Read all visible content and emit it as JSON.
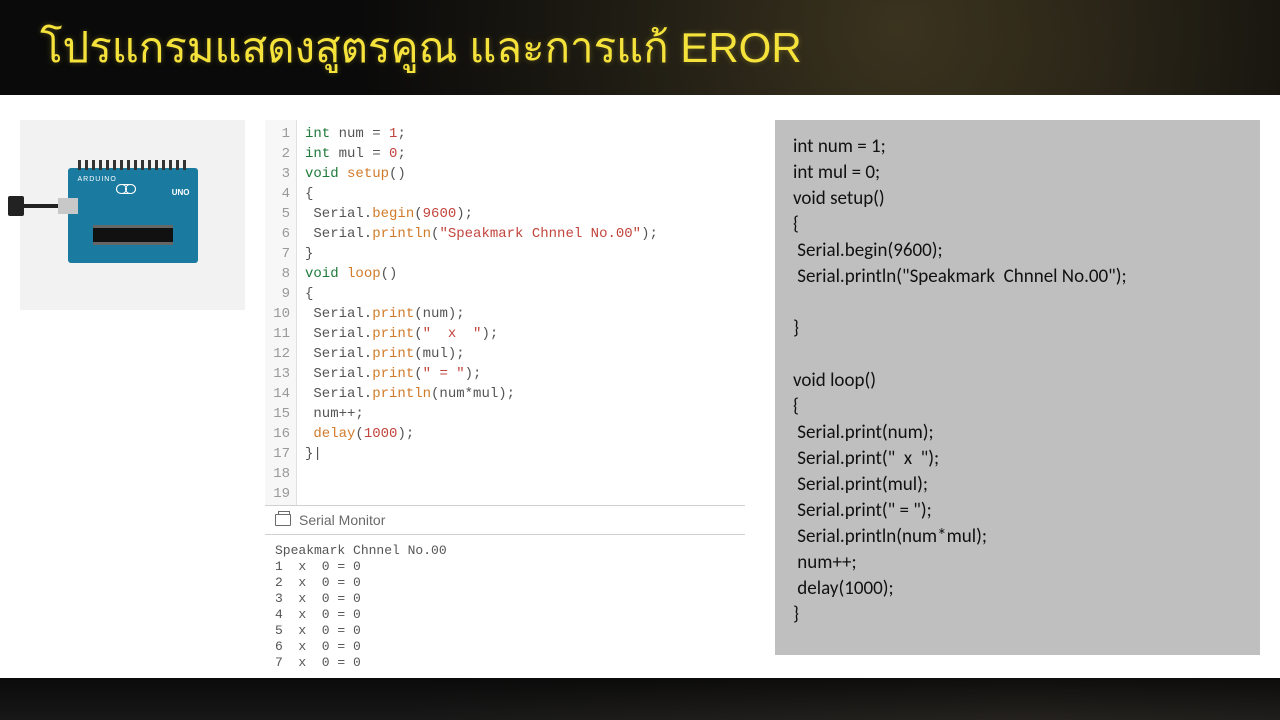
{
  "header": {
    "title": "โปรแกรมแสดงสูตรคูณ และการแก้ EROR"
  },
  "board": {
    "brand": "ARDUINO",
    "model": "UNO"
  },
  "editor": {
    "lines": [
      {
        "n": 1,
        "t": "int num = 1;",
        "tokens": [
          [
            "kw",
            "int"
          ],
          [
            "",
            " num "
          ],
          [
            "punct",
            "="
          ],
          [
            "",
            " "
          ],
          [
            "num",
            "1"
          ],
          [
            "punct",
            ";"
          ]
        ]
      },
      {
        "n": 2,
        "t": "int mul = 0;",
        "tokens": [
          [
            "kw",
            "int"
          ],
          [
            "",
            " mul "
          ],
          [
            "punct",
            "="
          ],
          [
            "",
            " "
          ],
          [
            "num",
            "0"
          ],
          [
            "punct",
            ";"
          ]
        ]
      },
      {
        "n": 3,
        "t": "void setup()",
        "tokens": [
          [
            "kw",
            "void"
          ],
          [
            "",
            " "
          ],
          [
            "fn",
            "setup"
          ],
          [
            "punct",
            "()"
          ]
        ]
      },
      {
        "n": 4,
        "t": "{",
        "tokens": [
          [
            "punct",
            "{"
          ]
        ]
      },
      {
        "n": 5,
        "t": " Serial.begin(9600);",
        "tokens": [
          [
            "",
            " Serial."
          ],
          [
            "fn",
            "begin"
          ],
          [
            "punct",
            "("
          ],
          [
            "num",
            "9600"
          ],
          [
            "punct",
            ");"
          ]
        ]
      },
      {
        "n": 6,
        "t": " Serial.println(\"Speakmark Chnnel No.00\");",
        "tokens": [
          [
            "",
            " Serial."
          ],
          [
            "fn",
            "println"
          ],
          [
            "punct",
            "("
          ],
          [
            "str",
            "\"Speakmark Chnnel No.00\""
          ],
          [
            "punct",
            ");"
          ]
        ]
      },
      {
        "n": 7,
        "t": " ",
        "tokens": [
          [
            "",
            ""
          ]
        ]
      },
      {
        "n": 8,
        "t": "}",
        "tokens": [
          [
            "punct",
            "}"
          ]
        ]
      },
      {
        "n": 9,
        "t": "",
        "tokens": [
          [
            "",
            ""
          ]
        ]
      },
      {
        "n": 10,
        "t": "void loop()",
        "tokens": [
          [
            "kw",
            "void"
          ],
          [
            "",
            " "
          ],
          [
            "fn",
            "loop"
          ],
          [
            "punct",
            "()"
          ]
        ]
      },
      {
        "n": 11,
        "t": "{",
        "tokens": [
          [
            "punct",
            "{"
          ]
        ]
      },
      {
        "n": 12,
        "t": " Serial.print(num);",
        "tokens": [
          [
            "",
            " Serial."
          ],
          [
            "fn",
            "print"
          ],
          [
            "punct",
            "(num);"
          ]
        ]
      },
      {
        "n": 13,
        "t": " Serial.print(\"  x  \");",
        "tokens": [
          [
            "",
            " Serial."
          ],
          [
            "fn",
            "print"
          ],
          [
            "punct",
            "("
          ],
          [
            "str",
            "\"  x  \""
          ],
          [
            "punct",
            ");"
          ]
        ]
      },
      {
        "n": 14,
        "t": " Serial.print(mul);",
        "tokens": [
          [
            "",
            " Serial."
          ],
          [
            "fn",
            "print"
          ],
          [
            "punct",
            "(mul);"
          ]
        ]
      },
      {
        "n": 15,
        "t": " Serial.print(\" = \");",
        "tokens": [
          [
            "",
            " Serial."
          ],
          [
            "fn",
            "print"
          ],
          [
            "punct",
            "("
          ],
          [
            "str",
            "\" = \""
          ],
          [
            "punct",
            ");"
          ]
        ]
      },
      {
        "n": 16,
        "t": " Serial.println(num*mul);",
        "tokens": [
          [
            "",
            " Serial."
          ],
          [
            "fn",
            "println"
          ],
          [
            "punct",
            "(num*mul);"
          ]
        ]
      },
      {
        "n": 17,
        "t": " num++;",
        "tokens": [
          [
            "",
            " num++;"
          ]
        ]
      },
      {
        "n": 18,
        "t": " delay(1000);",
        "tokens": [
          [
            "",
            " "
          ],
          [
            "fn",
            "delay"
          ],
          [
            "punct",
            "("
          ],
          [
            "num",
            "1000"
          ],
          [
            "punct",
            ");"
          ]
        ]
      },
      {
        "n": 19,
        "t": "}",
        "tokens": [
          [
            "punct",
            "}|"
          ]
        ]
      }
    ]
  },
  "serial": {
    "title": "Serial Monitor",
    "output": "Speakmark Chnnel No.00\n1  x  0 = 0\n2  x  0 = 0\n3  x  0 = 0\n4  x  0 = 0\n5  x  0 = 0\n6  x  0 = 0\n7  x  0 = 0"
  },
  "right_code": "int num = 1;\nint mul = 0;\nvoid setup()\n{\n Serial.begin(9600);\n Serial.println(\"Speakmark  Chnnel No.00\");\n\n}\n\nvoid loop()\n{\n Serial.print(num);\n Serial.print(\"  x  \");\n Serial.print(mul);\n Serial.print(\" = \");\n Serial.println(num*mul);\n num++;\n delay(1000);\n}"
}
